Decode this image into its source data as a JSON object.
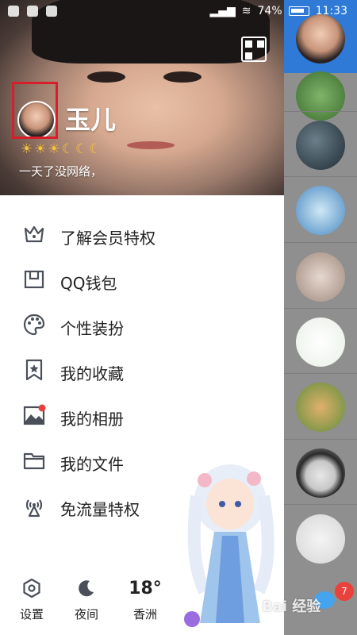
{
  "status_bar": {
    "battery": "74%",
    "time": "11:33"
  },
  "profile": {
    "name": "玉儿",
    "level": "☀☀☀☾☾☾",
    "signature": "一天了没网络，"
  },
  "menu": [
    {
      "label": "了解会员特权",
      "icon": "crown-icon"
    },
    {
      "label": "QQ钱包",
      "icon": "wallet-icon"
    },
    {
      "label": "个性装扮",
      "icon": "palette-icon"
    },
    {
      "label": "我的收藏",
      "icon": "bookmark-star-icon"
    },
    {
      "label": "我的相册",
      "icon": "photo-icon",
      "badge": true
    },
    {
      "label": "我的文件",
      "icon": "folder-icon"
    },
    {
      "label": "免流量特权",
      "icon": "signal-tower-icon"
    }
  ],
  "bottom_bar": {
    "settings_label": "设置",
    "night_label": "夜间",
    "temperature": "18°",
    "location": "香洲"
  },
  "chat_list": {
    "unread_badge": "7"
  },
  "watermark": "Bai 经验",
  "colors": {
    "accent_blue": "#2e7ad6",
    "badge_red": "#e9413b",
    "highlight_red": "#d61f2a",
    "icon_gray": "#4a4f5a"
  }
}
